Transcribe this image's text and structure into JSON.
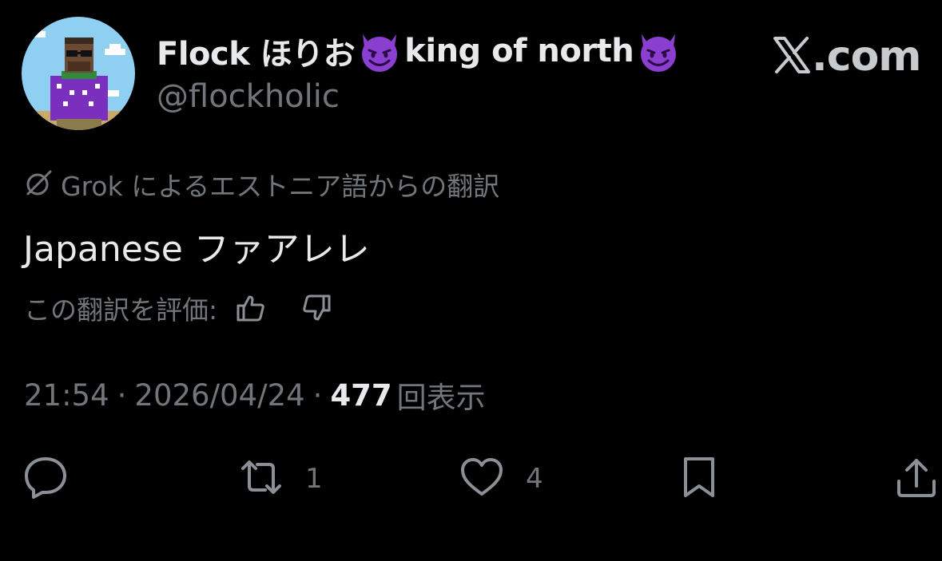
{
  "header": {
    "display_name_part1": "Flock ほりお",
    "display_name_part2": "king of north",
    "emoji_name": "smiling-face-with-horns",
    "handle": "@flockholic",
    "site_domain": ".com",
    "site_logo_icon": "x-logo-icon"
  },
  "translation": {
    "icon": "grok-icon",
    "label": "Grok によるエストニア語からの翻訳"
  },
  "post": {
    "text": "Japanese ファアレレ"
  },
  "rating": {
    "label": "この翻訳を評価:",
    "up_icon": "thumbs-up-icon",
    "down_icon": "thumbs-down-icon"
  },
  "meta": {
    "time": "21:54",
    "separator": "·",
    "date": "2026/04/24",
    "views_count": "477",
    "views_label": "回表示"
  },
  "actions": {
    "reply": {
      "icon": "reply-icon",
      "count": ""
    },
    "repost": {
      "icon": "repost-icon",
      "count": "1"
    },
    "like": {
      "icon": "heart-icon",
      "count": "4"
    },
    "bookmark": {
      "icon": "bookmark-icon",
      "count": ""
    },
    "share": {
      "icon": "share-icon",
      "count": ""
    }
  },
  "colors": {
    "background": "#000000",
    "primary_text": "#e7e9ea",
    "secondary_text": "#71767b",
    "emoji_purple": "#8a3fd1"
  }
}
